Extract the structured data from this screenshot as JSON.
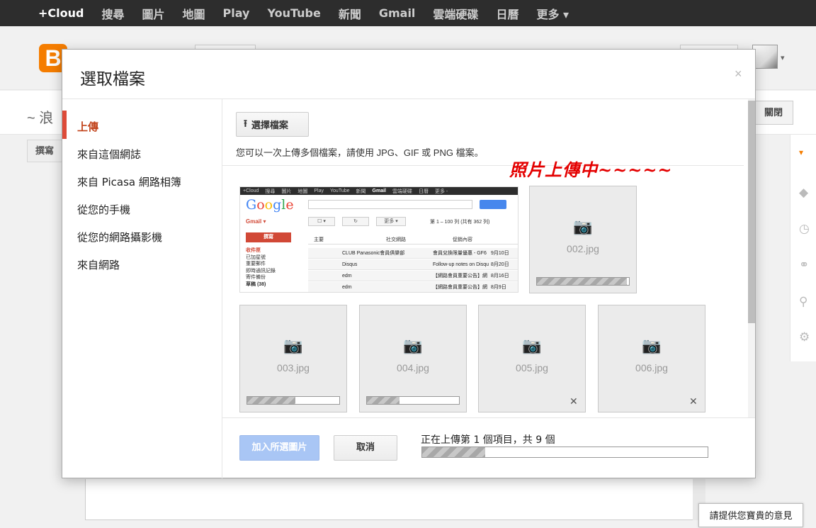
{
  "topbar": {
    "items": [
      "+Cloud",
      "搜尋",
      "圖片",
      "地圖",
      "Play",
      "YouTube",
      "新聞",
      "Gmail",
      "雲端硬碟",
      "日曆",
      "更多 ▾"
    ]
  },
  "background": {
    "logo_letter": "B",
    "post_title_fragment": "~ 浪",
    "close_label": "關閉",
    "compose_tab_label": "撰寫",
    "feedback_label": "請提供您寶貴的意見"
  },
  "modal": {
    "title": "選取檔案",
    "close_glyph": "×",
    "nav_items": [
      "上傳",
      "來自這個網誌",
      "來自 Picasa 網路相簿",
      "從您的手機",
      "從您的網路攝影機",
      "來自網路"
    ],
    "active_index": 0,
    "choose_button_label": "選擇檔案",
    "hint": "您可以一次上傳多個檔案，請使用 JPG、GIF 或 PNG 檔案。",
    "annotation": "照片上傳中~~~~~",
    "add_button_label": "加入所選圖片",
    "cancel_button_label": "取消",
    "progress_text": "正在上傳第 1 個項目，共 9 個",
    "progress_fraction": 0.22
  },
  "thumbnails": [
    {
      "filename": "002.jpg",
      "progress": 0.98,
      "cancellable": false
    },
    {
      "filename": "003.jpg",
      "progress": 0.52,
      "cancellable": false
    },
    {
      "filename": "004.jpg",
      "progress": 0.35,
      "cancellable": false
    },
    {
      "filename": "005.jpg",
      "progress": 0,
      "cancellable": true
    },
    {
      "filename": "006.jpg",
      "progress": 0,
      "cancellable": true
    }
  ],
  "preview": {
    "top_items": [
      "+Cloud",
      "搜尋",
      "圖片",
      "地圖",
      "Play",
      "YouTube",
      "新聞",
      "Gmail",
      "雲端硬碟",
      "日曆",
      "更多 -"
    ],
    "logo": "Google",
    "label": "Gmail ▾",
    "more": "更多 ▾",
    "count": "第 1 – 100 列 (共有 362 列)",
    "compose": "撰寫",
    "tabs": [
      "主要",
      "社交網路",
      "促銷內容"
    ],
    "folders": [
      "收件匣",
      "已加星號",
      "重要郵件",
      "即時通訊記錄",
      "寄件備份",
      "草稿 (38)"
    ],
    "rows": [
      {
        "sender": "CLUB Panasonic會員俱樂部",
        "subject": "會員兌換限量優惠 - GF6",
        "date": "9月10日"
      },
      {
        "sender": "Disqus",
        "subject": "Follow-up notes on Disqu",
        "date": "8月20日"
      },
      {
        "sender": "edm",
        "subject": "【網路會員重要公告】網",
        "date": "8月16日"
      },
      {
        "sender": "edm",
        "subject": "【網路會員重要公告】網",
        "date": "8月9日"
      }
    ]
  }
}
